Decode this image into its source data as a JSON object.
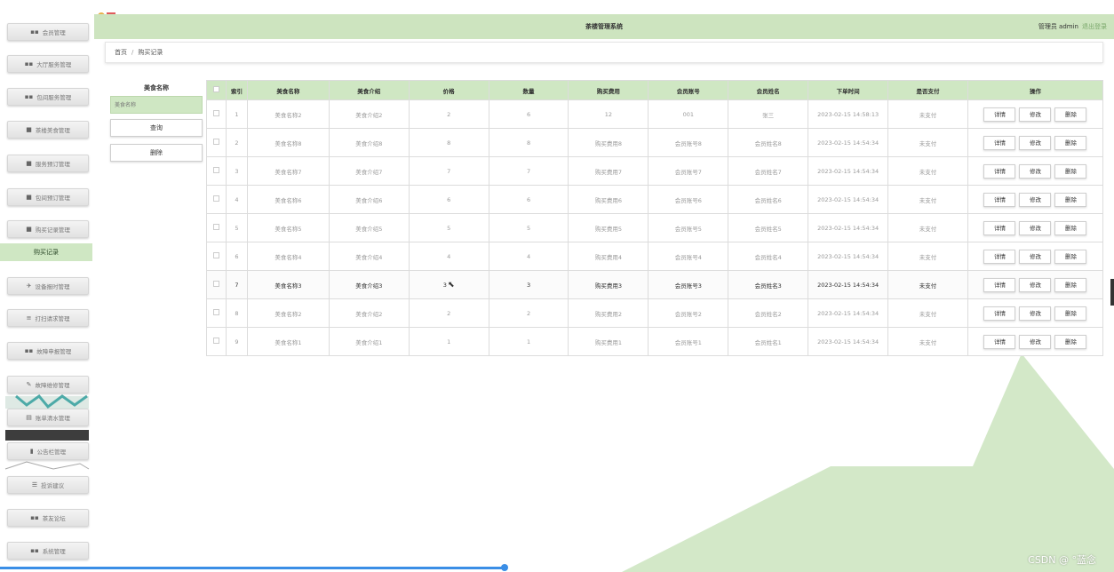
{
  "header": {
    "title": "茶楼管理系统",
    "user": "管理员 admin",
    "logout": "退出登录"
  },
  "sidebar": {
    "items": [
      {
        "label": "会员管理",
        "icon": "grid-icon"
      },
      {
        "label": "大厅服务管理",
        "icon": "grid-icon"
      },
      {
        "label": "包间服务管理",
        "icon": "grid-icon"
      },
      {
        "label": "茶楼美食管理",
        "icon": "card-icon"
      },
      {
        "label": "服务预订管理",
        "icon": "card-icon"
      },
      {
        "label": "包间预订管理",
        "icon": "card-icon"
      },
      {
        "label": "购买记录管理",
        "icon": "card-icon"
      },
      {
        "label": "设备报时管理",
        "icon": "send-icon"
      },
      {
        "label": "打扫请求管理",
        "icon": "list-icon"
      },
      {
        "label": "故障申报管理",
        "icon": "grid-icon"
      },
      {
        "label": "故障维修管理",
        "icon": "tool-icon"
      },
      {
        "label": "账单清水管理",
        "icon": "list-icon"
      },
      {
        "label": "公告栏管理",
        "icon": "chart-icon"
      },
      {
        "label": "投诉建议",
        "icon": "menu-icon"
      },
      {
        "label": "茶友论坛",
        "icon": "grid-icon"
      },
      {
        "label": "系统管理",
        "icon": "grid-icon"
      }
    ],
    "active_sub": "购买记录"
  },
  "breadcrumb": {
    "home": "首页",
    "separator": "/",
    "current": "购买记录"
  },
  "search": {
    "label": "美食名称",
    "placeholder": "美食名称",
    "query_button": "查询",
    "delete_button": "删除"
  },
  "table": {
    "headers": [
      "",
      "索引",
      "美食名称",
      "美食介绍",
      "价格",
      "数量",
      "购买费用",
      "会员账号",
      "会员姓名",
      "下单时间",
      "是否支付",
      "操作"
    ],
    "actions": {
      "detail": "详情",
      "edit": "修改",
      "delete": "删除"
    },
    "rows": [
      {
        "index": "1",
        "name": "美食名称2",
        "intro": "美食介绍2",
        "price": "2",
        "qty": "6",
        "cost": "12",
        "account": "001",
        "member": "张三",
        "time": "2023-02-15 14:58:13",
        "paid": "未支付"
      },
      {
        "index": "2",
        "name": "美食名称8",
        "intro": "美食介绍8",
        "price": "8",
        "qty": "8",
        "cost": "购买费用8",
        "account": "会员账号8",
        "member": "会员姓名8",
        "time": "2023-02-15 14:54:34",
        "paid": "未支付"
      },
      {
        "index": "3",
        "name": "美食名称7",
        "intro": "美食介绍7",
        "price": "7",
        "qty": "7",
        "cost": "购买费用7",
        "account": "会员账号7",
        "member": "会员姓名7",
        "time": "2023-02-15 14:54:34",
        "paid": "未支付"
      },
      {
        "index": "4",
        "name": "美食名称6",
        "intro": "美食介绍6",
        "price": "6",
        "qty": "6",
        "cost": "购买费用6",
        "account": "会员账号6",
        "member": "会员姓名6",
        "time": "2023-02-15 14:54:34",
        "paid": "未支付"
      },
      {
        "index": "5",
        "name": "美食名称5",
        "intro": "美食介绍5",
        "price": "5",
        "qty": "5",
        "cost": "购买费用5",
        "account": "会员账号5",
        "member": "会员姓名5",
        "time": "2023-02-15 14:54:34",
        "paid": "未支付"
      },
      {
        "index": "6",
        "name": "美食名称4",
        "intro": "美食介绍4",
        "price": "4",
        "qty": "4",
        "cost": "购买费用4",
        "account": "会员账号4",
        "member": "会员姓名4",
        "time": "2023-02-15 14:54:34",
        "paid": "未支付"
      },
      {
        "index": "7",
        "name": "美食名称3",
        "intro": "美食介绍3",
        "price": "3",
        "qty": "3",
        "cost": "购买费用3",
        "account": "会员账号3",
        "member": "会员姓名3",
        "time": "2023-02-15 14:54:34",
        "paid": "未支付"
      },
      {
        "index": "8",
        "name": "美食名称2",
        "intro": "美食介绍2",
        "price": "2",
        "qty": "2",
        "cost": "购买费用2",
        "account": "会员账号2",
        "member": "会员姓名2",
        "time": "2023-02-15 14:54:34",
        "paid": "未支付"
      },
      {
        "index": "9",
        "name": "美食名称1",
        "intro": "美食介绍1",
        "price": "1",
        "qty": "1",
        "cost": "购买费用1",
        "account": "会员账号1",
        "member": "会员姓名1",
        "time": "2023-02-15 14:54:34",
        "paid": "未支付"
      }
    ]
  },
  "watermark": "CSDN @ °蓝念",
  "colors": {
    "accent": "#cfe7c3",
    "header": "#cde4bf",
    "background_shape": "#d3e8c8"
  }
}
